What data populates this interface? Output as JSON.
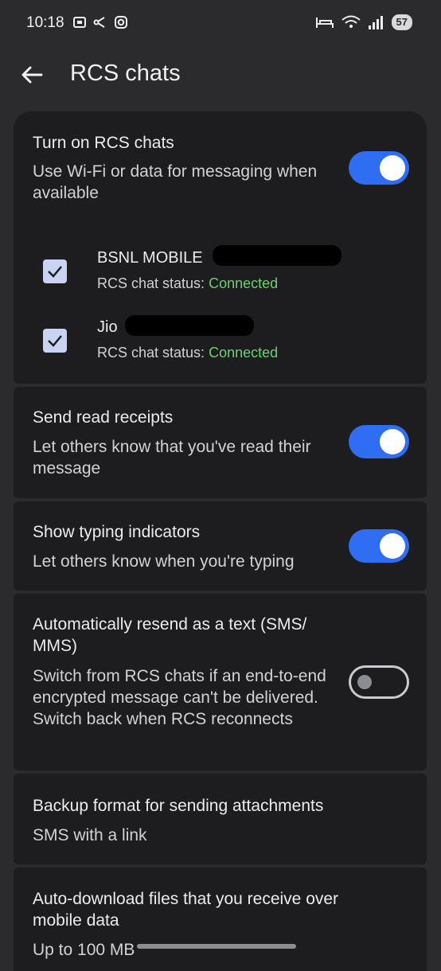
{
  "status_bar": {
    "time": "10:18",
    "battery": "57"
  },
  "header": {
    "title": "RCS chats"
  },
  "rcs": {
    "title": "Turn on RCS chats",
    "subtitle": "Use Wi-Fi or data for messaging when available",
    "enabled": true,
    "sims": [
      {
        "name": "BSNL MOBILE",
        "status_label": "RCS chat status:",
        "status": "Connected",
        "checked": true
      },
      {
        "name": "Jio",
        "status_label": "RCS chat status:",
        "status": "Connected",
        "checked": true
      }
    ]
  },
  "read_receipts": {
    "title": "Send read receipts",
    "subtitle": "Let others know that you've read their message",
    "enabled": true
  },
  "typing": {
    "title": "Show typing indicators",
    "subtitle": "Let others know when you're typing",
    "enabled": true
  },
  "resend": {
    "title": "Automatically resend as a text (SMS/ MMS)",
    "subtitle": "Switch from RCS chats if an end-to-end encrypted message can't be delivered. Switch back when RCS reconnects",
    "enabled": false
  },
  "backup": {
    "title": "Backup format for sending attachments",
    "value": "SMS with a link"
  },
  "autodownload": {
    "title": "Auto-download files that you receive over mobile data",
    "value": "Up to 100 MB"
  },
  "colors": {
    "accent": "#2f6ef2",
    "connected": "#6fcf73",
    "card": "#1d1d20",
    "background": "#2b2b2d"
  }
}
